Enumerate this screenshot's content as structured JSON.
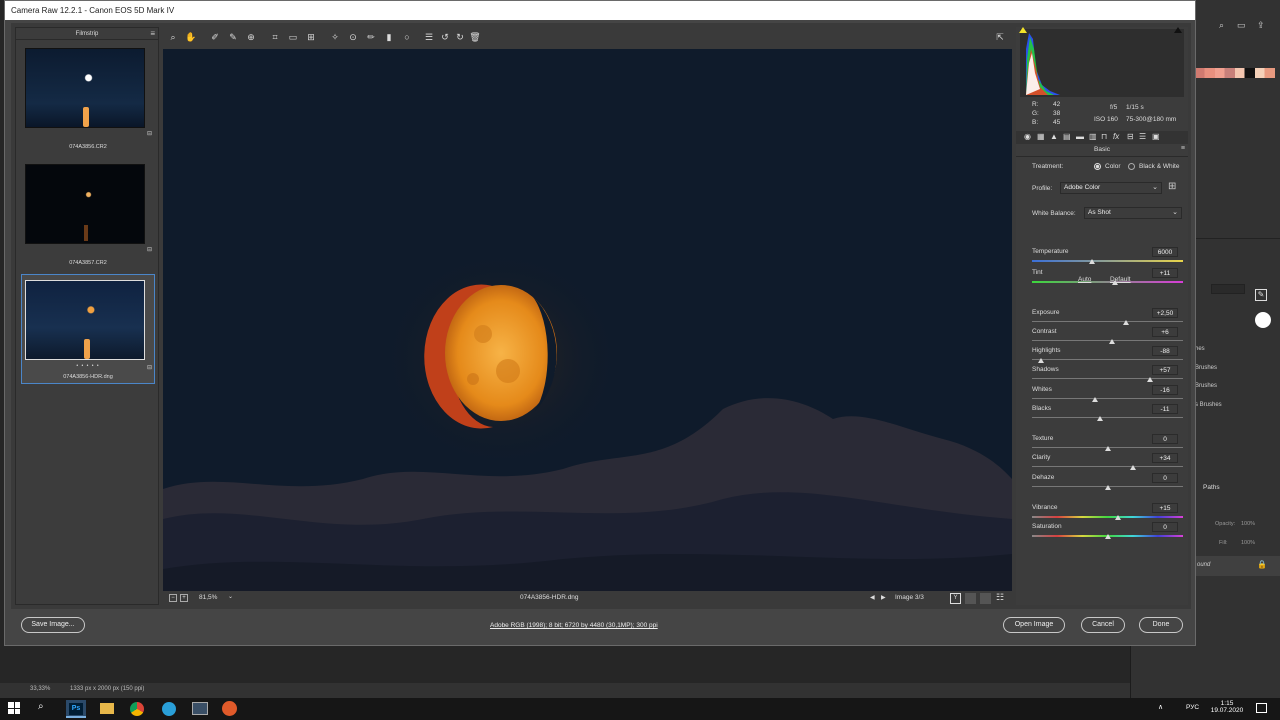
{
  "window": {
    "title": "Camera Raw 12.2.1  -  Canon EOS 5D Mark IV"
  },
  "filmstrip": {
    "title": "Filmstrip",
    "items": [
      {
        "name": "074A3856.CR2"
      },
      {
        "name": "074A3857.CR2"
      },
      {
        "name": "074A3856-HDR.dng",
        "stars": "• • • • •"
      }
    ]
  },
  "preview": {
    "zoom": "81,5%",
    "filename": "074A3856-HDR.dng",
    "image_counter": "Image 3/3"
  },
  "readout": {
    "r_label": "R:",
    "r": "42",
    "g_label": "G:",
    "g": "38",
    "b_label": "B:",
    "b": "45",
    "aperture": "f/5",
    "shutter": "1/15 s",
    "iso": "ISO 160",
    "lens": "75-300@180 mm"
  },
  "basic": {
    "section": "Basic",
    "treatment_label": "Treatment:",
    "treatment_color": "Color",
    "treatment_bw": "Black & White",
    "profile_label": "Profile:",
    "profile_value": "Adobe Color",
    "wb_label": "White Balance:",
    "wb_value": "As Shot",
    "auto": "Auto",
    "default": "Default",
    "sliders": [
      {
        "label": "Temperature",
        "value": "6000",
        "pos": 0.4
      },
      {
        "label": "Tint",
        "value": "+11",
        "pos": 0.55
      },
      {
        "label": "Exposure",
        "value": "+2,50",
        "pos": 0.62
      },
      {
        "label": "Contrast",
        "value": "+6",
        "pos": 0.53
      },
      {
        "label": "Highlights",
        "value": "-88",
        "pos": 0.06
      },
      {
        "label": "Shadows",
        "value": "+57",
        "pos": 0.78
      },
      {
        "label": "Whites",
        "value": "-16",
        "pos": 0.42
      },
      {
        "label": "Blacks",
        "value": "-11",
        "pos": 0.45
      },
      {
        "label": "Texture",
        "value": "0",
        "pos": 0.5
      },
      {
        "label": "Clarity",
        "value": "+34",
        "pos": 0.67
      },
      {
        "label": "Dehaze",
        "value": "0",
        "pos": 0.5
      },
      {
        "label": "Vibrance",
        "value": "+15",
        "pos": 0.57
      },
      {
        "label": "Saturation",
        "value": "0",
        "pos": 0.5
      }
    ]
  },
  "footer": {
    "save": "Save Image...",
    "info": "Adobe RGB (1998); 8 bit; 6720 by 4480 (30,1MP); 300 ppi",
    "open": "Open Image",
    "cancel": "Cancel",
    "done": "Done"
  },
  "photoshop": {
    "zoom": "33,33%",
    "doc_info": "1333 px x 2000 px (150 ppi)",
    "brush_items": [
      "hes",
      "Brushes",
      "Brushes",
      "s Brushes"
    ],
    "paths_tab": "Paths",
    "opacity_label": "Opacity:",
    "opacity": "100%",
    "fill_label": "Fill:",
    "fill": "100%",
    "layer_name": "ound"
  },
  "taskbar": {
    "lang": "РУС",
    "time": "1:15",
    "date": "19.07.2020"
  }
}
